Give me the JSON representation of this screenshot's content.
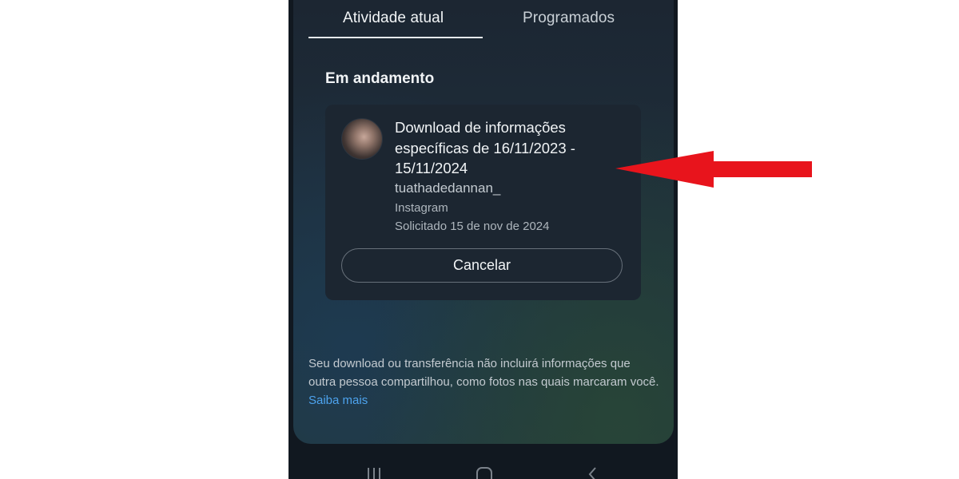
{
  "tabs": [
    {
      "label": "Atividade atual",
      "active": true
    },
    {
      "label": "Programados",
      "active": false
    }
  ],
  "section": {
    "title": "Em andamento"
  },
  "request": {
    "title": "Download de informações específicas de 16/11/2023 - 15/11/2024",
    "username": "tuathadedannan_",
    "platform": "Instagram",
    "requested": "Solicitado 15 de nov de 2024",
    "cancel_label": "Cancelar"
  },
  "footnote": {
    "text": "Seu download ou transferência não incluirá informações que outra pessoa compartilhou, como fotos nas quais marcaram você.",
    "link": "Saiba mais"
  },
  "navbar": {
    "icons": [
      "recents-icon",
      "home-icon",
      "back-icon"
    ]
  },
  "colors": {
    "annotation_arrow": "#e8141c",
    "link": "#4da3ee",
    "sheet_background": "#1e2d3a"
  }
}
